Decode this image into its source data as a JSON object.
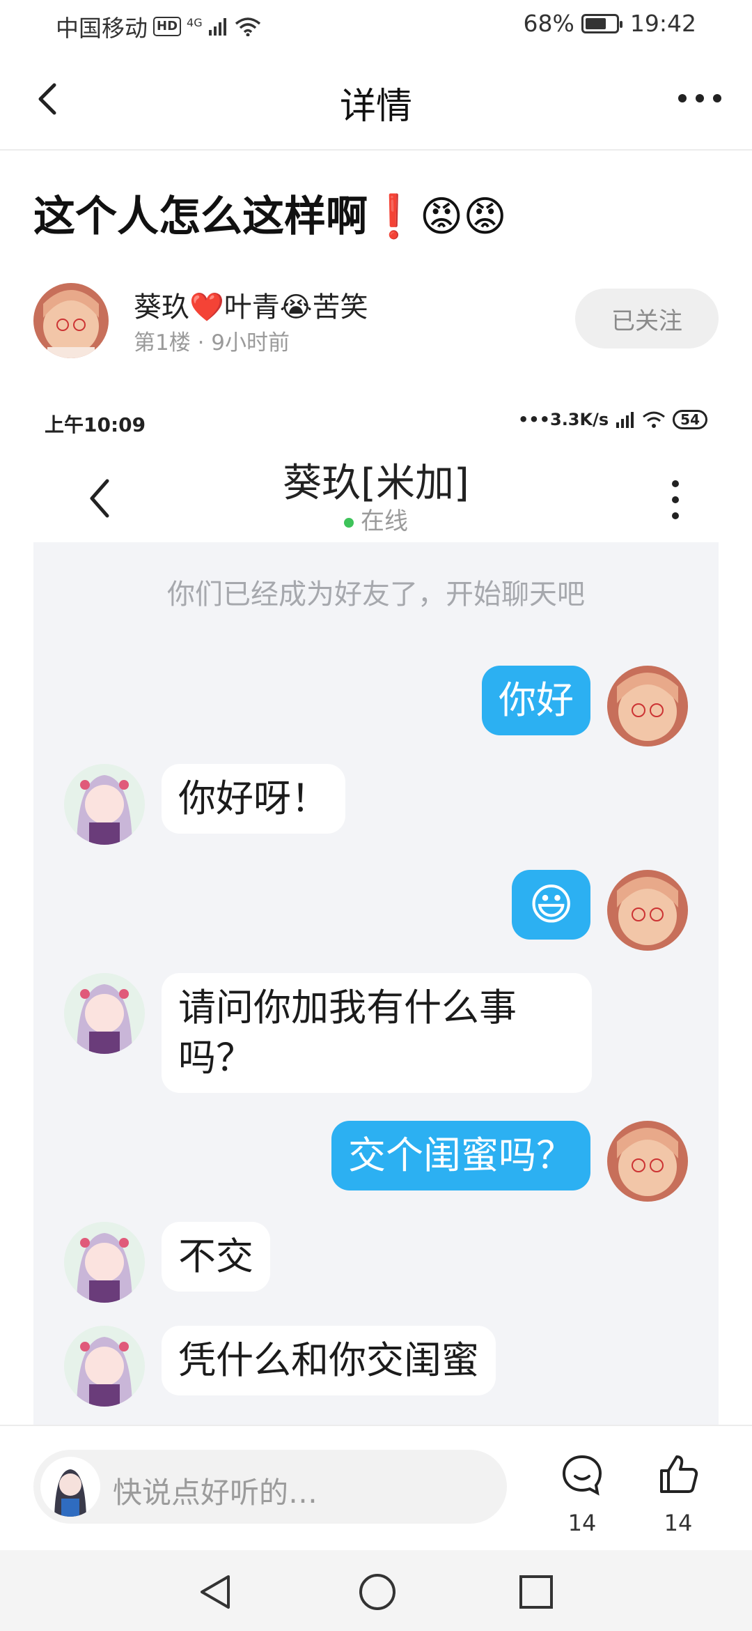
{
  "status_bar": {
    "carrier": "中国移动",
    "hd": "HD",
    "net": "4G",
    "battery": "68%",
    "battery_level": 0.68,
    "time": "19:42"
  },
  "nav": {
    "title": "详情"
  },
  "post": {
    "title": "这个人怎么这样啊❗😡😡"
  },
  "author": {
    "name": "葵玖❤️叶青😭苦笑",
    "meta": "第1楼 · 9小时前",
    "follow_label": "已关注"
  },
  "screenshot": {
    "status": {
      "time": "上午10:09",
      "speed": "•••3.3K/s",
      "battery": "54"
    },
    "chat_title": "葵玖[米加]",
    "online": "在线",
    "system_message": "你们已经成为好友了，开始聊天吧",
    "messages": [
      {
        "from": "me",
        "text": "你好"
      },
      {
        "from": "other",
        "text": "你好呀！"
      },
      {
        "from": "me",
        "text": "😃"
      },
      {
        "from": "other",
        "text": "请问你加我有什么事吗？"
      },
      {
        "from": "me",
        "text": "交个闺蜜吗？"
      },
      {
        "from": "other",
        "text": "不交"
      },
      {
        "from": "other",
        "text": "凭什么和你交闺蜜"
      }
    ]
  },
  "bottom": {
    "placeholder": "快说点好听的…",
    "comments": "14",
    "likes": "14"
  },
  "colors": {
    "my_bubble": "#2cb0f2",
    "chat_bg": "#f3f4f7",
    "online_dot": "#3ec35a"
  }
}
